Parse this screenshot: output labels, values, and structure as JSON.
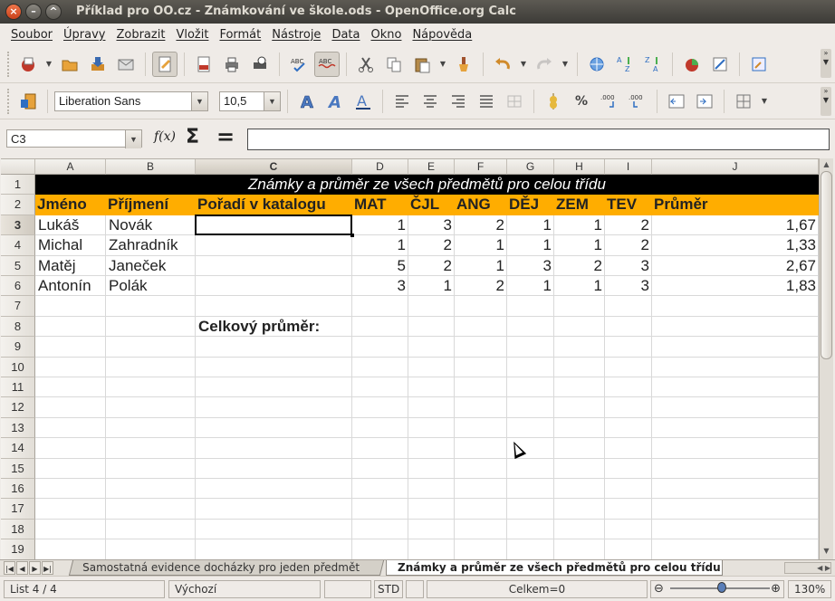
{
  "window": {
    "title": "Příklad pro OO.cz - Známkování ve škole.ods - OpenOffice.org Calc",
    "close_glyph": "×",
    "minimize_glyph": "–",
    "maximize_glyph": "^"
  },
  "menu": [
    "Soubor",
    "Úpravy",
    "Zobrazit",
    "Vložit",
    "Formát",
    "Nástroje",
    "Data",
    "Okno",
    "Nápověda"
  ],
  "formatting": {
    "font_name": "Liberation Sans",
    "font_size": "10,5"
  },
  "formula_bar": {
    "name_box": "C3",
    "fx_label": "f(x)",
    "sum_label": "Σ",
    "equals_label": "=",
    "formula": ""
  },
  "sheet": {
    "columns": [
      "A",
      "B",
      "C",
      "D",
      "E",
      "F",
      "G",
      "H",
      "I",
      "J"
    ],
    "active_column": "C",
    "active_row": 3,
    "rows": [
      "1",
      "2",
      "3",
      "4",
      "5",
      "6",
      "7",
      "8",
      "9",
      "10",
      "11",
      "12",
      "13",
      "14",
      "15",
      "16",
      "17",
      "18",
      "19"
    ],
    "title": "Známky a průměr ze všech předmětů pro celou třídu",
    "headers": [
      "Jméno",
      "Příjmení",
      "Pořadí v katalogu",
      "MAT",
      "ČJL",
      "ANG",
      "DĚJ",
      "ZEM",
      "TEV",
      "Průměr"
    ],
    "students": [
      {
        "first": "Lukáš",
        "last": "Novák",
        "order": "",
        "grades": [
          "1",
          "3",
          "2",
          "1",
          "1",
          "2"
        ],
        "avg": "1,67"
      },
      {
        "first": "Michal",
        "last": "Zahradník",
        "order": "",
        "grades": [
          "1",
          "2",
          "1",
          "1",
          "1",
          "2"
        ],
        "avg": "1,33"
      },
      {
        "first": "Matěj",
        "last": "Janeček",
        "order": "",
        "grades": [
          "5",
          "2",
          "1",
          "3",
          "2",
          "3"
        ],
        "avg": "2,67"
      },
      {
        "first": "Antonín",
        "last": "Polák",
        "order": "",
        "grades": [
          "3",
          "1",
          "2",
          "1",
          "1",
          "3"
        ],
        "avg": "1,83"
      }
    ],
    "overall_label": "Celkový průměr:"
  },
  "tabs": [
    {
      "label": "Samostatná evidence docházky pro jeden předmět",
      "active": false
    },
    {
      "label": "Známky a průměr ze všech předmětů pro celou třídu",
      "active": true
    }
  ],
  "status": {
    "sheet_info": "List 4 / 4",
    "page_style": "Výchozí",
    "mode": "STD",
    "sum": "Celkem=0",
    "zoom": "130%",
    "zoom_minus": "⊖",
    "zoom_plus": "⊕"
  }
}
